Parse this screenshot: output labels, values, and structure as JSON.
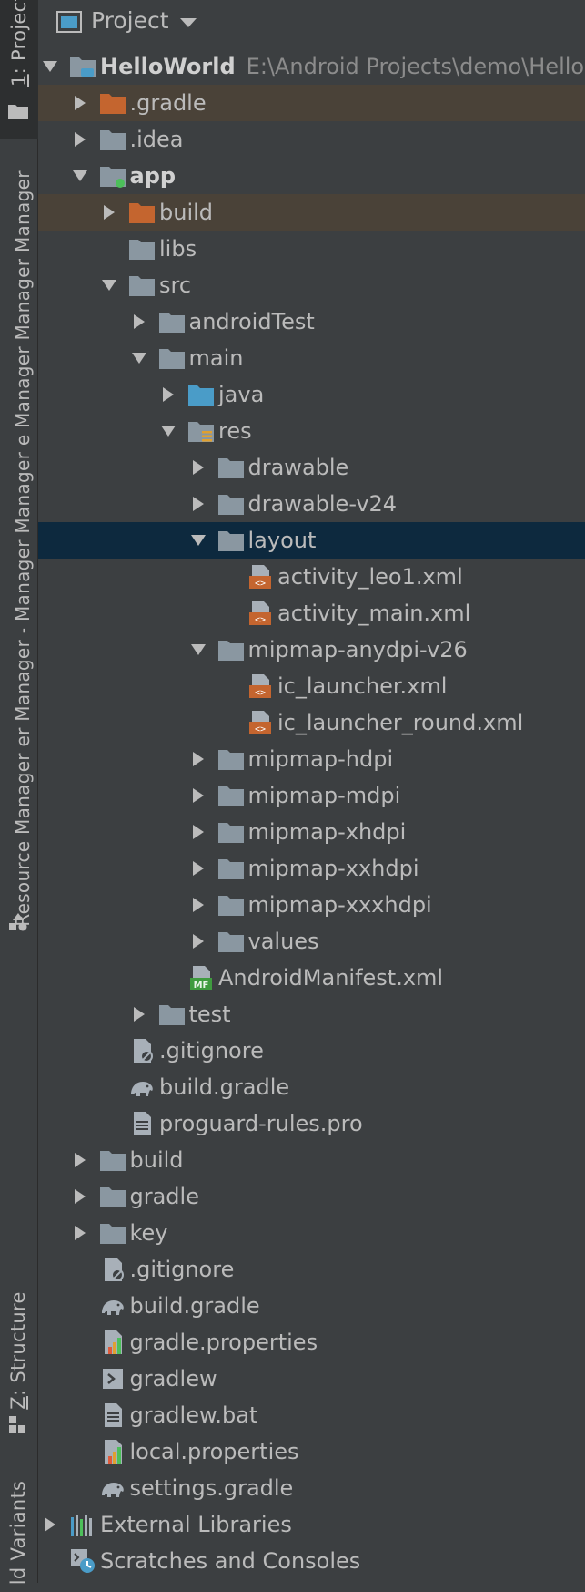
{
  "sidebar": {
    "tabs": [
      {
        "label_prefix": "1",
        "label_rest": ": Project",
        "active": true
      },
      {
        "label": "Resource Manager er  Manager ˗ Manager  Manager e Manager  Manager  Manager"
      },
      {
        "label_prefix": "Z",
        "label_rest": ": Structure"
      },
      {
        "label": "ld Variants"
      }
    ]
  },
  "header": {
    "title": "Project"
  },
  "tree": [
    {
      "depth": 0,
      "arrow": "down",
      "icon": "module-icon",
      "label": "HelloWorld",
      "bold": true,
      "path": "E:\\Android Projects\\demo\\HelloW"
    },
    {
      "depth": 1,
      "arrow": "right",
      "icon": "folder-excluded-icon",
      "label": ".gradle",
      "highlight": "excluded"
    },
    {
      "depth": 1,
      "arrow": "right",
      "icon": "folder-icon",
      "label": ".idea"
    },
    {
      "depth": 1,
      "arrow": "down",
      "icon": "module-folder-icon",
      "label": "app",
      "bold": true
    },
    {
      "depth": 2,
      "arrow": "right",
      "icon": "folder-excluded-icon",
      "label": "build",
      "highlight": "excluded"
    },
    {
      "depth": 2,
      "arrow": "",
      "icon": "folder-icon",
      "label": "libs"
    },
    {
      "depth": 2,
      "arrow": "down",
      "icon": "folder-icon",
      "label": "src"
    },
    {
      "depth": 3,
      "arrow": "right",
      "icon": "folder-icon",
      "label": "androidTest"
    },
    {
      "depth": 3,
      "arrow": "down",
      "icon": "folder-icon",
      "label": "main"
    },
    {
      "depth": 4,
      "arrow": "right",
      "icon": "source-folder-icon",
      "label": "java"
    },
    {
      "depth": 4,
      "arrow": "down",
      "icon": "resource-folder-icon",
      "label": "res"
    },
    {
      "depth": 5,
      "arrow": "right",
      "icon": "folder-icon",
      "label": "drawable"
    },
    {
      "depth": 5,
      "arrow": "right",
      "icon": "folder-icon",
      "label": "drawable-v24"
    },
    {
      "depth": 5,
      "arrow": "down",
      "icon": "folder-icon",
      "label": "layout",
      "selected": true
    },
    {
      "depth": 6,
      "arrow": "",
      "icon": "xml-file-icon",
      "label": "activity_leo1.xml"
    },
    {
      "depth": 6,
      "arrow": "",
      "icon": "xml-file-icon",
      "label": "activity_main.xml"
    },
    {
      "depth": 5,
      "arrow": "down",
      "icon": "folder-icon",
      "label": "mipmap-anydpi-v26"
    },
    {
      "depth": 6,
      "arrow": "",
      "icon": "xml-file-icon",
      "label": "ic_launcher.xml"
    },
    {
      "depth": 6,
      "arrow": "",
      "icon": "xml-file-icon",
      "label": "ic_launcher_round.xml"
    },
    {
      "depth": 5,
      "arrow": "right",
      "icon": "folder-icon",
      "label": "mipmap-hdpi"
    },
    {
      "depth": 5,
      "arrow": "right",
      "icon": "folder-icon",
      "label": "mipmap-mdpi"
    },
    {
      "depth": 5,
      "arrow": "right",
      "icon": "folder-icon",
      "label": "mipmap-xhdpi"
    },
    {
      "depth": 5,
      "arrow": "right",
      "icon": "folder-icon",
      "label": "mipmap-xxhdpi"
    },
    {
      "depth": 5,
      "arrow": "right",
      "icon": "folder-icon",
      "label": "mipmap-xxxhdpi"
    },
    {
      "depth": 5,
      "arrow": "right",
      "icon": "folder-icon",
      "label": "values"
    },
    {
      "depth": 4,
      "arrow": "",
      "icon": "manifest-file-icon",
      "label": "AndroidManifest.xml"
    },
    {
      "depth": 3,
      "arrow": "right",
      "icon": "folder-icon",
      "label": "test"
    },
    {
      "depth": 2,
      "arrow": "",
      "icon": "gitignore-file-icon",
      "label": ".gitignore"
    },
    {
      "depth": 2,
      "arrow": "",
      "icon": "gradle-elephant-icon",
      "label": "build.gradle"
    },
    {
      "depth": 2,
      "arrow": "",
      "icon": "text-file-icon",
      "label": "proguard-rules.pro"
    },
    {
      "depth": 1,
      "arrow": "right",
      "icon": "folder-icon",
      "label": "build"
    },
    {
      "depth": 1,
      "arrow": "right",
      "icon": "folder-icon",
      "label": "gradle"
    },
    {
      "depth": 1,
      "arrow": "right",
      "icon": "folder-icon",
      "label": "key"
    },
    {
      "depth": 1,
      "arrow": "",
      "icon": "gitignore-file-icon",
      "label": ".gitignore"
    },
    {
      "depth": 1,
      "arrow": "",
      "icon": "gradle-elephant-icon",
      "label": "build.gradle"
    },
    {
      "depth": 1,
      "arrow": "",
      "icon": "properties-file-icon",
      "label": "gradle.properties"
    },
    {
      "depth": 1,
      "arrow": "",
      "icon": "shell-script-icon",
      "label": "gradlew"
    },
    {
      "depth": 1,
      "arrow": "",
      "icon": "text-file-icon",
      "label": "gradlew.bat"
    },
    {
      "depth": 1,
      "arrow": "",
      "icon": "properties-file-icon",
      "label": "local.properties"
    },
    {
      "depth": 1,
      "arrow": "",
      "icon": "gradle-elephant-icon",
      "label": "settings.gradle"
    },
    {
      "depth": 0,
      "arrow": "right",
      "icon": "libraries-icon",
      "label": "External Libraries"
    },
    {
      "depth": 0,
      "arrow": "",
      "icon": "scratches-icon",
      "label": "Scratches and Consoles"
    }
  ],
  "colors": {
    "background": "#3c3f41",
    "selection": "#0d293e",
    "excluded_highlight": "#4a4238",
    "folder": "#8a97a1",
    "excluded_folder": "#c4652f",
    "source_folder": "#4a9cc8",
    "xml_badge": "#c4652f",
    "manifest_badge": "#3f9b3f"
  }
}
